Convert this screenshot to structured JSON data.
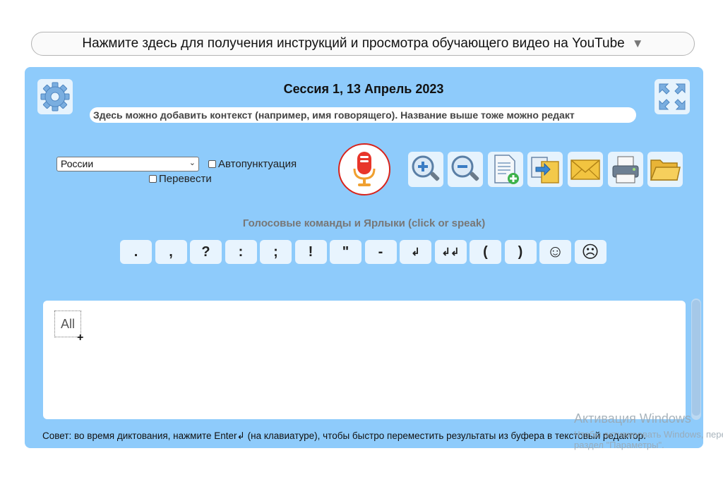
{
  "header": {
    "instructions": "Нажмите здесь для получения инструкций и просмотра обучающего видео на YouTube",
    "arrow": "▼"
  },
  "session": {
    "title": "Сессия 1, 13 Апрель 2023",
    "context_placeholder": "Здесь можно добавить контекст (например, имя говорящего). Название выше тоже можно редакт"
  },
  "controls": {
    "language": "России",
    "autopunct_label": "Автопунктуация",
    "translate_label": "Перевести"
  },
  "toolbar": {
    "buttons": [
      {
        "name": "zoom-in",
        "icon": "zoom-in-icon"
      },
      {
        "name": "zoom-out",
        "icon": "zoom-out-icon"
      },
      {
        "name": "new-document",
        "icon": "new-document-icon"
      },
      {
        "name": "copy",
        "icon": "copy-icon"
      },
      {
        "name": "email",
        "icon": "email-icon"
      },
      {
        "name": "print",
        "icon": "printer-icon"
      },
      {
        "name": "open-folder",
        "icon": "folder-icon"
      }
    ]
  },
  "commands": {
    "title": "Голосовые команды и Ярлыки (click or speak)",
    "items": [
      ".",
      ",",
      "?",
      ":",
      ";",
      "!",
      "\"",
      "-",
      "↲",
      "↲↲",
      "(",
      ")",
      "☺",
      "☹"
    ]
  },
  "editor": {
    "tag": "All"
  },
  "footer": {
    "tip": "Совет: во время диктования, нажмите Enter↲ (на клавиатуре), чтобы быстро переместить результаты из буфера в текстовый редактор."
  },
  "watermark": {
    "line1": "Активация Windows",
    "line2": "Чтобы активировать Windows, перейдите в",
    "line3": "раздел \"Параметры\"."
  },
  "colors": {
    "panel": "#8ecbfb",
    "mic_red": "#d8241c",
    "button_bg": "#e6f3fd"
  }
}
